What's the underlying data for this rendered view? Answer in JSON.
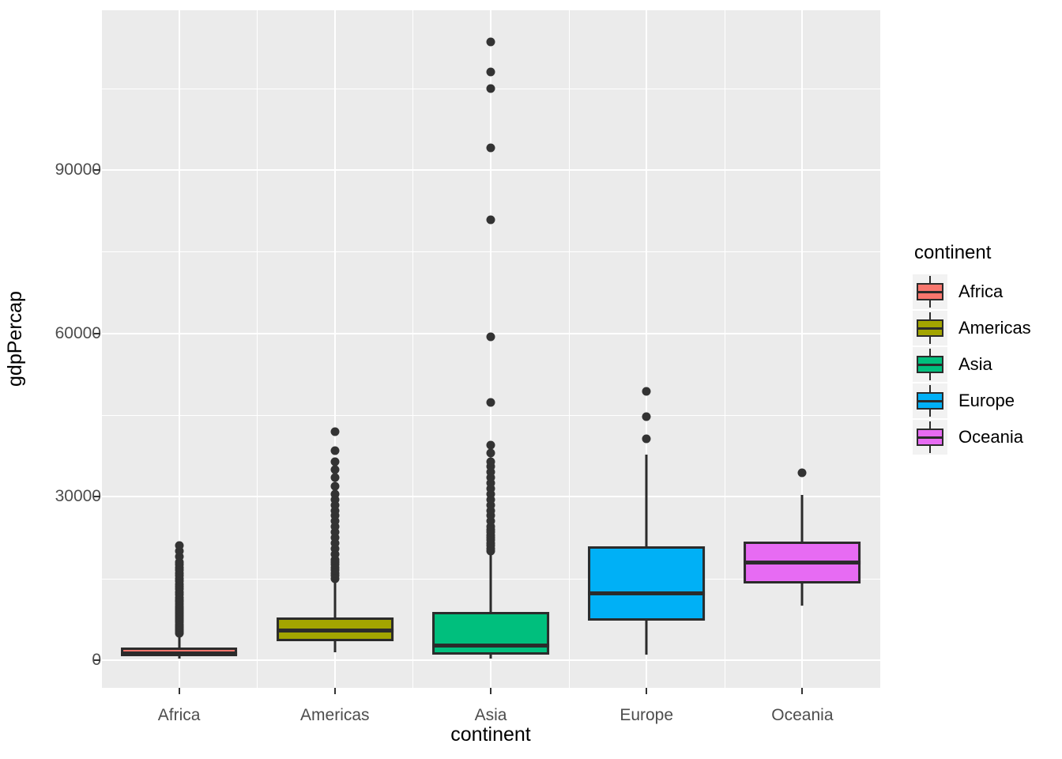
{
  "chart_data": {
    "type": "box",
    "title": "",
    "xlabel": "continent",
    "ylabel": "gdpPercap",
    "grid": true,
    "legend_position": "right",
    "legend_title": "continent",
    "categories": [
      "Africa",
      "Americas",
      "Asia",
      "Europe",
      "Oceania"
    ],
    "y_ticks": [
      0,
      30000,
      60000,
      90000
    ],
    "y_tick_labels": [
      "0",
      "30000",
      "60000",
      "90000"
    ],
    "ylim": [
      -4000,
      120000
    ],
    "y_minor_ticks": [
      15000,
      45000,
      75000,
      105000
    ],
    "colors": {
      "Africa": "#F8766D",
      "Americas": "#A3A500",
      "Asia": "#00BF7D",
      "Europe": "#00B0F6",
      "Oceania": "#E76BF3",
      "panel_background": "#EBEBEB",
      "grid": "#FFFFFF",
      "outline": "#2B2B2B",
      "outlier": "#333333",
      "axis_text": "#4D4D4D",
      "legend_key_background": "#F2F2F2"
    },
    "series": [
      {
        "name": "Africa",
        "color": "#F8766D",
        "min_whisker": 241,
        "q1": 761,
        "median": 1206,
        "q3": 2377,
        "max_whisker": 4770,
        "outliers": [
          4900,
          5100,
          5300,
          5500,
          5700,
          5900,
          6100,
          6350,
          6600,
          6900,
          7200,
          7500,
          7800,
          8100,
          8400,
          8700,
          9000,
          9300,
          9600,
          9900,
          10300,
          10700,
          11100,
          11500,
          12000,
          12500,
          13000,
          13500,
          14000,
          14500,
          15000,
          15500,
          16000,
          16500,
          17000,
          17500,
          18000,
          19000,
          20000,
          21000
        ]
      },
      {
        "name": "Americas",
        "color": "#A3A500",
        "min_whisker": 1397,
        "q1": 3428,
        "median": 5466,
        "q3": 7830,
        "max_whisker": 14300,
        "outliers": [
          15000,
          15500,
          16000,
          16500,
          17000,
          17500,
          18000,
          18500,
          19500,
          20500,
          21500,
          22500,
          23500,
          24500,
          25500,
          26500,
          27500,
          28500,
          29500,
          30500,
          32000,
          33500,
          35000,
          36500,
          38500,
          42000
        ]
      },
      {
        "name": "Asia",
        "color": "#00BF7D",
        "min_whisker": 331,
        "q1": 1056,
        "median": 2647,
        "q3": 8882,
        "max_whisker": 19500,
        "outliers": [
          20000,
          20500,
          21000,
          21500,
          22000,
          22500,
          23000,
          23500,
          24000,
          24500,
          25500,
          26500,
          27500,
          28500,
          29500,
          30500,
          31500,
          32500,
          33500,
          34500,
          35500,
          36500,
          38000,
          39500,
          47300,
          59300,
          80900,
          94000,
          105000,
          108000,
          113500
        ]
      },
      {
        "name": "Europe",
        "color": "#00B0F6",
        "min_whisker": 974,
        "q1": 7213,
        "median": 12270,
        "q3": 20900,
        "max_whisker": 37800,
        "outliers": [
          40700,
          44700,
          49400
        ]
      },
      {
        "name": "Oceania",
        "color": "#E76BF3",
        "min_whisker": 10040,
        "q1": 14100,
        "median": 17983,
        "q3": 21800,
        "max_whisker": 30300,
        "outliers": [
          34400
        ]
      }
    ]
  },
  "legend": {
    "title": "continent",
    "items": [
      {
        "label": "Africa",
        "color": "#F8766D"
      },
      {
        "label": "Americas",
        "color": "#A3A500"
      },
      {
        "label": "Asia",
        "color": "#00BF7D"
      },
      {
        "label": "Europe",
        "color": "#00B0F6"
      },
      {
        "label": "Oceania",
        "color": "#E76BF3"
      }
    ]
  },
  "axes": {
    "x_title": "continent",
    "y_title": "gdpPercap",
    "x_tick_labels": [
      "Africa",
      "Americas",
      "Asia",
      "Europe",
      "Oceania"
    ],
    "y_tick_labels": [
      "0",
      "30000",
      "60000",
      "90000"
    ]
  }
}
